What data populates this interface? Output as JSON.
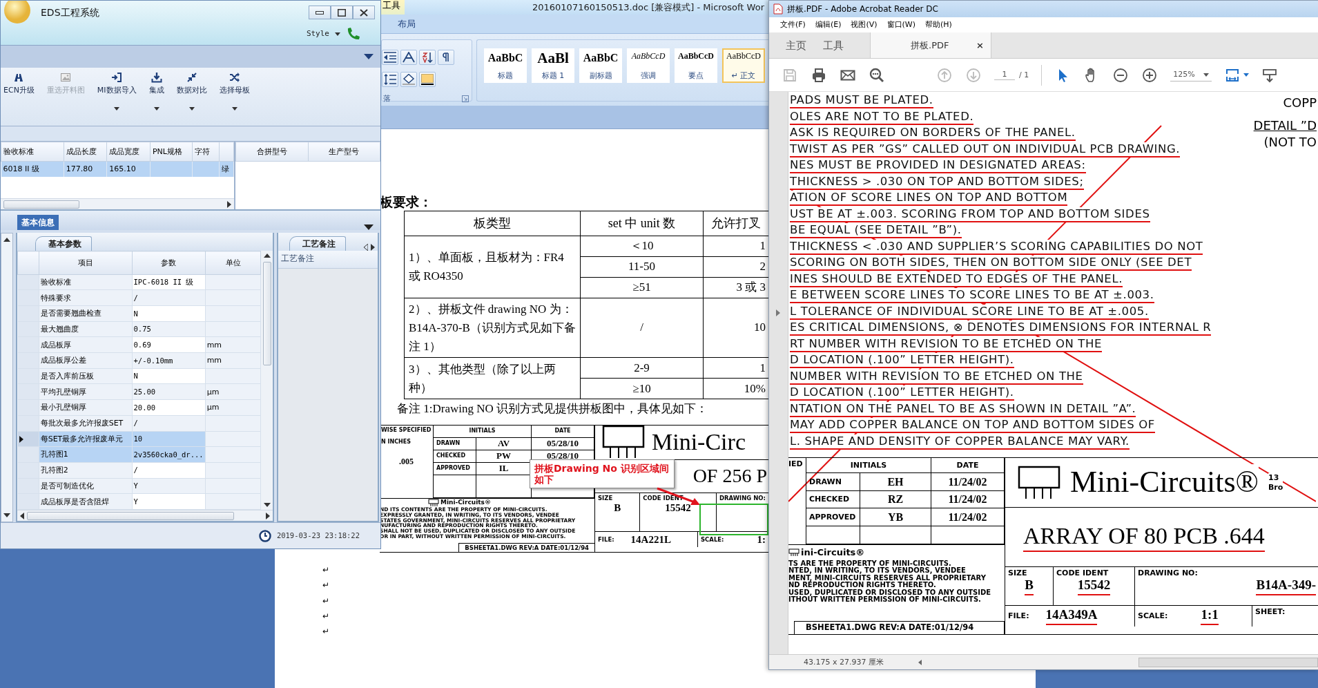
{
  "eds": {
    "title": "EDS工程系统",
    "style_label": "Style",
    "toolbar": [
      {
        "label": "ECN升级",
        "disabled": false,
        "dropdown": false
      },
      {
        "label": "重选开料图",
        "disabled": true,
        "dropdown": false
      },
      {
        "label": "MI数据导入",
        "disabled": false,
        "dropdown": true
      },
      {
        "label": "集成",
        "disabled": false,
        "dropdown": true
      },
      {
        "label": "数据对比",
        "disabled": false,
        "dropdown": true
      },
      {
        "label": "选择母板",
        "disabled": false,
        "dropdown": true
      }
    ],
    "grid": {
      "columns": [
        "验收标准",
        "成品长度",
        "成品宽度",
        "PNL规格",
        "字符"
      ],
      "rows": [
        {
          "selected": true,
          "cells": [
            "6018 II 级",
            "177.80",
            "165.10",
            null,
            null,
            "绿"
          ]
        }
      ]
    },
    "merge_grid": {
      "columns": [
        "合拼型号",
        "生产型号"
      ]
    },
    "section_tab": "基本信息",
    "params_tab": "基本参数",
    "params": {
      "columns": [
        "项目",
        "参数",
        "单位"
      ],
      "rows": [
        {
          "item": "验收标准",
          "value": "IPC-6018 II 级",
          "selected": false,
          "current": false
        },
        {
          "item": "特殊要求",
          "value": "/",
          "selected": false,
          "current": false
        },
        {
          "item": "是否需要翘曲检查",
          "value": "N",
          "selected": false,
          "current": false
        },
        {
          "item": "最大翘曲度",
          "value": "0.75",
          "selected": false,
          "current": false
        },
        {
          "item": "成品板厚",
          "value": "0.69",
          "unit": "mm",
          "selected": false,
          "current": false
        },
        {
          "item": "成品板厚公差",
          "value": "+/-0.10mm",
          "unit": "mm",
          "selected": false,
          "current": false
        },
        {
          "item": "是否入库前压板",
          "value": "N",
          "selected": false,
          "current": false
        },
        {
          "item": "平均孔壁铜厚",
          "value": "25.00",
          "unit": "μm",
          "selected": false,
          "current": false
        },
        {
          "item": "最小孔壁铜厚",
          "value": "20.00",
          "unit": "μm",
          "selected": false,
          "current": false
        },
        {
          "item": "每批次最多允许报废SET",
          "value": "/",
          "selected": false,
          "current": false
        },
        {
          "item": "每SET最多允许报废单元",
          "value": "10",
          "selected": true,
          "current": true
        },
        {
          "item": "孔符图1",
          "value": "2v3560cka0_dr...",
          "selected": true,
          "current": false
        },
        {
          "item": "孔符图2",
          "value": "/",
          "selected": false,
          "current": false
        },
        {
          "item": "是否可制造优化",
          "value": "Y",
          "selected": false,
          "current": false
        },
        {
          "item": "成品板厚是否含阻焊",
          "value": "Y",
          "selected": false,
          "current": false
        }
      ]
    },
    "notes_tab": "工艺备注",
    "notes_header": "工艺备注",
    "status_time": "2019-03-23 23:18:22"
  },
  "word": {
    "context_tab": "工具",
    "title": "20160107160150513.doc [兼容模式] - Microsoft Wor",
    "ribbon_tab": "布局",
    "group_label": "落",
    "styles": [
      {
        "sample": "AaBbC",
        "name": "标题",
        "kind": "title",
        "selected": false
      },
      {
        "sample": "AaBl",
        "name": "标题 1",
        "kind": "heading",
        "selected": false
      },
      {
        "sample": "AaBbC",
        "name": "副标题",
        "kind": "subtitle",
        "selected": false
      },
      {
        "sample": "AaBbCcD",
        "name": "强调",
        "kind": "emphasis",
        "selected": false
      },
      {
        "sample": "AaBbCcD",
        "name": "要点",
        "kind": "strong",
        "selected": false
      },
      {
        "sample": "AaBbCcD",
        "name": "↵ 正文",
        "kind": "normal",
        "selected": true
      }
    ],
    "doc": {
      "heading": "板要求：",
      "table": {
        "columns": [
          "板类型",
          "set 中 unit 数",
          "允许打叉"
        ],
        "groups": [
          {
            "type": "1）、单面板，且板材为：FR4 或 RO4350",
            "rows": [
              {
                "units": "＜10",
                "allowed": "1"
              },
              {
                "units": "11-50",
                "allowed": "2"
              },
              {
                "units": "≥51",
                "allowed": "3 或 3"
              }
            ]
          },
          {
            "type": "2）、拼板文件 drawing NO 为：B14A-370-B（识别方式见如下备注 1）",
            "rows": [
              {
                "units": "/",
                "allowed": "10"
              }
            ]
          },
          {
            "type": "3）、其他类型（除了以上两种）",
            "rows": [
              {
                "units": "2-9",
                "allowed": "1"
              },
              {
                "units": "≥10",
                "allowed": "10%"
              }
            ]
          }
        ]
      },
      "note": "备注 1:Drawing NO 识别方式见提供拼板图中，具体见如下：",
      "figure": {
        "spec": [
          "WISE SPECIFIED",
          "N INCHES",
          ".005"
        ],
        "approval_header": [
          "INITIALS",
          "DATE"
        ],
        "approvals": [
          {
            "role": "DRAWN",
            "initials": "AV",
            "date": "05/28/10"
          },
          {
            "role": "CHECKED",
            "initials": "PW",
            "date": "05/28/10"
          },
          {
            "role": "APPROVED",
            "initials": "IL"
          }
        ],
        "small_logo": "Mini-Circuits®",
        "legal": [
          "ND ITS CONTENTS ARE THE PROPERTY OF MINI-CIRCUITS.",
          "EXPRESSLY GRANTED, IN WRITING, TO ITS VENDORS, VENDEE",
          "STATES GOVERNMENT, MINI-CIRCUITS  RESERVES ALL PROPRIETARY",
          "NUFACTURING AND REPRODUCTION RIGHTS THERETO.",
          "SHALL NOT BE USED, DUPLICATED OR DISCLOSED TO ANY OUTSIDE",
          "OR IN PART, WITHOUT WRITTEN PERMISSION OF MINI-CIRCUITS."
        ],
        "sheet": "BSHEETA1.DWG  REV:A   DATE:01/12/94",
        "logo": "Mini-Circ",
        "description": "OF 256 P",
        "size_label": "SIZE",
        "size": "B",
        "code_label": "CODE IDENT",
        "code": "15542",
        "drawing_label": "DRAWING NO:",
        "file_label": "FILE:",
        "file": "14A221L",
        "scale_label": "SCALE:",
        "scale": "1:"
      },
      "callout": "拼板Drawing No 识别区域间如下",
      "para_marks": [
        "↵",
        "↵",
        "↵",
        "↵",
        "↵"
      ]
    }
  },
  "acrobat": {
    "title": "拼板.PDF - Adobe Acrobat Reader DC",
    "menu": [
      "文件(F)",
      "编辑(E)",
      "视图(V)",
      "窗口(W)",
      "帮助(H)"
    ],
    "tabs": [
      {
        "label": "主页",
        "selected": false
      },
      {
        "label": "工具",
        "selected": false
      },
      {
        "label": "拼板.PDF",
        "selected": true,
        "close": "×"
      }
    ],
    "page": "1",
    "page_total": "/ 1",
    "zoom": "125%",
    "doc": {
      "side_notes": [
        "COPP",
        "DETAIL ”D",
        "(NOT TO"
      ],
      "lines": [
        {
          "text": "PADS MUST BE PLATED.",
          "struck": true
        },
        {
          "text": "OLES ARE NOT TO BE PLATED.",
          "struck": true
        },
        {
          "text": "ASK IS REQUIRED ON BORDERS OF THE PANEL.",
          "struck": true
        },
        {
          "text": "TWIST AS PER ”GS” CALLED OUT ON INDIVIDUAL PCB DRAWING.",
          "struck": true
        },
        {
          "text": "NES MUST BE PROVIDED IN DESIGNATED AREAS:",
          "struck": true
        },
        {
          "text": "THICKNESS > .030 ON TOP AND BOTTOM SIDES;",
          "struck": true
        },
        {
          "text": "ATION OF SCORE LINES ON TOP AND BOTTOM",
          "struck": true
        },
        {
          "text": "UST BE AT ±.003. SCORING FROM TOP AND BOTTOM SIDES",
          "struck": true
        },
        {
          "text": "BE EQUAL (SEE DETAIL ”B”).",
          "struck": true
        },
        {
          "text": "THICKNESS < .030 AND SUPPLIER’S SCORING CAPABILITIES DO NOT",
          "struck": true
        },
        {
          "text": "SCORING ON BOTH SIDES, THEN ON BOTTOM SIDE ONLY (SEE DET",
          "struck": true
        },
        {
          "text": "INES SHOULD BE EXTENDED TO EDGES OF THE PANEL.",
          "struck": true
        },
        {
          "text": "E BETWEEN SCORE LINES TO SCORE LINES TO BE AT ±.003.",
          "struck": true
        },
        {
          "text": "L TOLERANCE OF INDIVIDUAL SCORE LINE TO BE AT ±.005.",
          "struck": true
        },
        {
          "text": "ES CRITICAL DIMENSIONS, ⊗ DENOTES DIMENSIONS FOR INTERNAL R",
          "struck": true
        },
        {
          "text": "RT NUMBER WITH REVISION TO BE ETCHED ON THE",
          "struck": true
        },
        {
          "text": "D LOCATION (.100” LETTER HEIGHT).",
          "struck": true
        },
        {
          "text": "NUMBER WITH REVISION TO BE ETCHED ON THE",
          "struck": true
        },
        {
          "text": "D LOCATION (.100” LETTER HEIGHT).",
          "struck": true
        },
        {
          "text": "NTATION ON THE PANEL TO BE AS SHOWN IN DETAIL ”A”.",
          "struck": true
        },
        {
          "text": "MAY ADD COPPER BALANCE ON TOP AND BOTTOM SIDES OF",
          "struck": true
        },
        {
          "text": "L. SHAPE AND DENSITY OF COPPER BALANCE MAY VARY.",
          "struck": true
        }
      ],
      "title_block": {
        "corner": "IED",
        "approval_header": [
          "INITIALS",
          "DATE"
        ],
        "approvals": [
          {
            "role": "DRAWN",
            "initials": "EH",
            "date": "11/24/02"
          },
          {
            "role": "CHECKED",
            "initials": "RZ",
            "date": "11/24/02"
          },
          {
            "role": "APPROVED",
            "initials": "YB",
            "date": "11/24/02"
          }
        ],
        "small_logo": "ini-Circuits®",
        "legal": [
          "TS ARE THE PROPERTY OF MINI-CIRCUITS.",
          "NTED, IN WRITING, TO ITS VENDORS, VENDEE",
          "MENT, MINI-CIRCUITS  RESERVES ALL PROPRIETARY",
          "ND REPRODUCTION RIGHTS THERETO.",
          "USED, DUPLICATED OR DISCLOSED TO ANY OUTSIDE",
          "ITHOUT WRITTEN PERMISSION OF MINI-CIRCUITS."
        ],
        "sheet": "BSHEETA1.DWG  REV:A   DATE:01/12/94",
        "logo": "Mini-Circuits®",
        "address": [
          "13",
          "Bro"
        ],
        "description": "ARRAY OF 80 PCB .644",
        "size_label": "SIZE",
        "size": "B",
        "code_label": "CODE IDENT",
        "code": "15542",
        "drawing_label": "DRAWING NO:",
        "drawing_no": "B14A-349-",
        "file_label": "FILE:",
        "file": "14A349A",
        "scale_label": "SCALE:",
        "scale": "1:1",
        "sheet_label": "SHEET:",
        "struck": true
      },
      "page_size": "43.175 x 27.937 厘米"
    }
  }
}
